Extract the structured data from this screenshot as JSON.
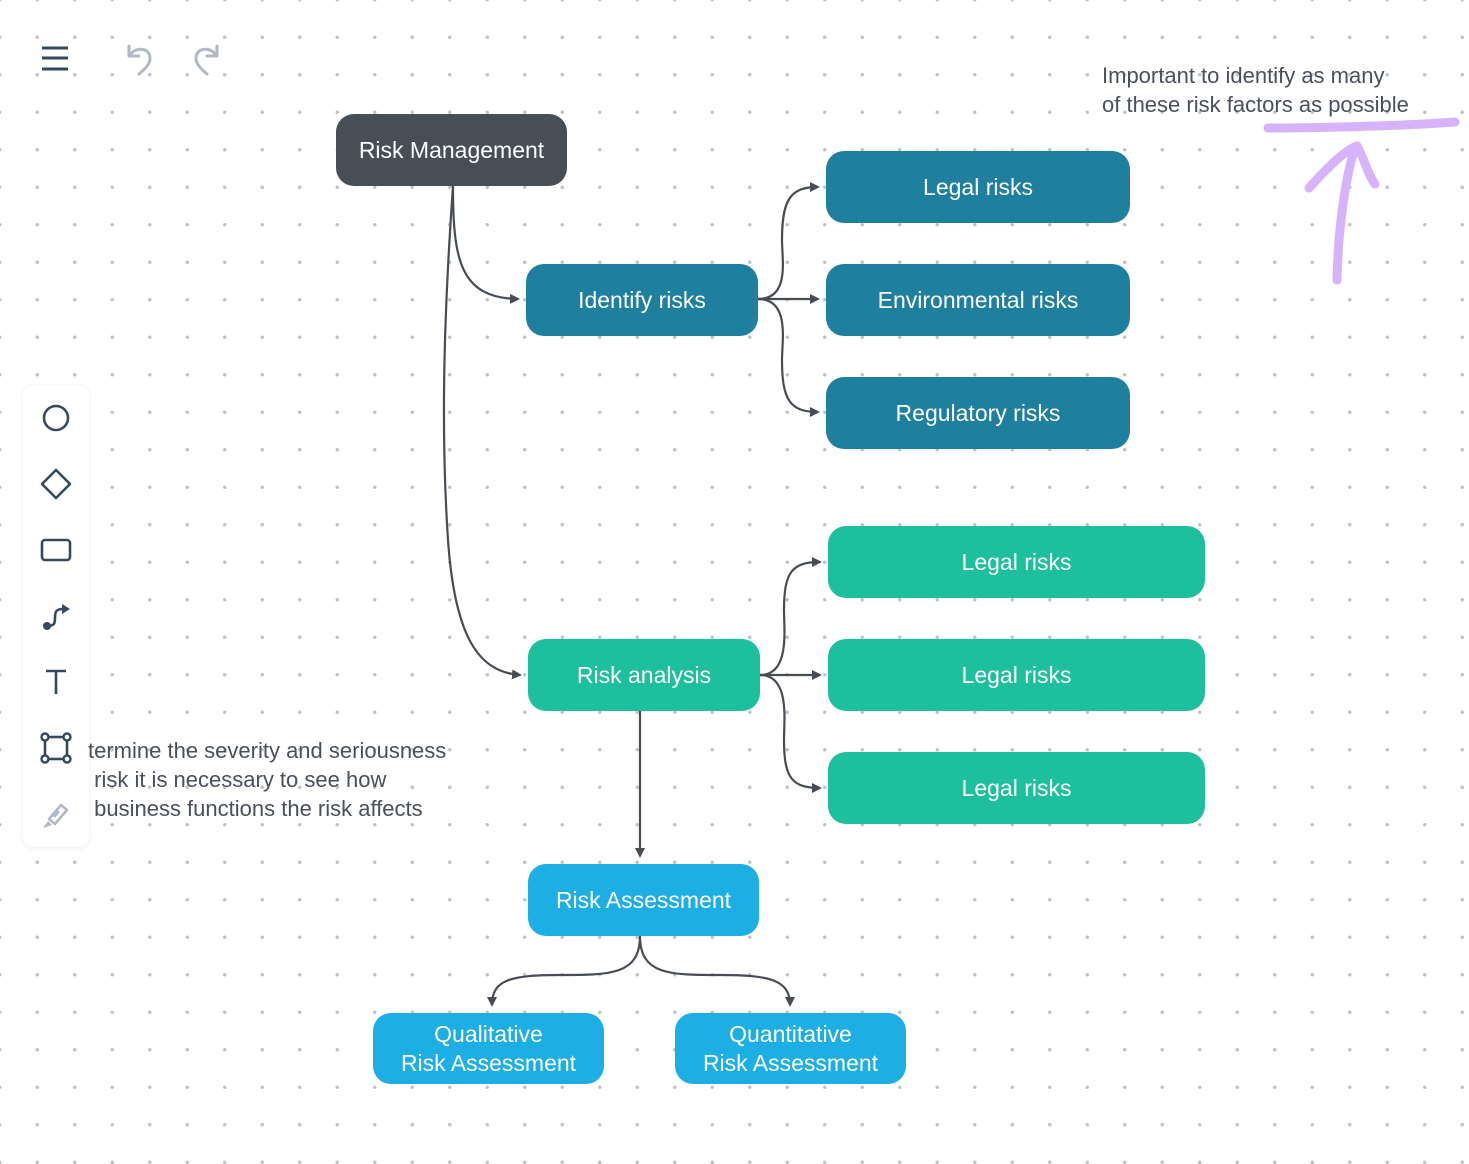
{
  "topbar": {
    "menu_icon": "hamburger-menu-icon",
    "undo_icon": "undo-icon",
    "redo_icon": "redo-icon"
  },
  "toolbar": {
    "tools": [
      {
        "name": "circle-tool",
        "icon": "circle-icon"
      },
      {
        "name": "diamond-tool",
        "icon": "diamond-icon"
      },
      {
        "name": "rectangle-tool",
        "icon": "rectangle-icon"
      },
      {
        "name": "connector-tool",
        "icon": "connector-icon"
      },
      {
        "name": "text-tool",
        "icon": "text-icon"
      },
      {
        "name": "frame-tool",
        "icon": "frame-icon"
      },
      {
        "name": "pen-tool",
        "icon": "pen-icon"
      }
    ]
  },
  "colors": {
    "root": "#484e56",
    "identify": "#1e7f9e",
    "analysis": "#1dbf9c",
    "assessment": "#1daee3",
    "edge": "#474c55",
    "annotation": "#d7b3fb"
  },
  "nodes": {
    "root": "Risk Management",
    "identify": "Identify risks",
    "identify_children": [
      "Legal risks",
      "Environmental risks",
      "Regulatory risks"
    ],
    "analysis": "Risk analysis",
    "analysis_children": [
      "Legal risks",
      "Legal risks",
      "Legal risks"
    ],
    "assessment": "Risk Assessment",
    "assessment_children": [
      "Qualitative\nRisk Assessment",
      "Quantitative\nRisk Assessment"
    ]
  },
  "notes": {
    "top_right": "Important to identify as many\nof these risk factors as possible",
    "left": "termine the severity and seriousness\n risk it is necessary to see how\n business functions the risk affects"
  },
  "edges": [
    {
      "from": "root",
      "to": "identify"
    },
    {
      "from": "root",
      "to": "analysis"
    },
    {
      "from": "identify",
      "to": "identify_children.0"
    },
    {
      "from": "identify",
      "to": "identify_children.1"
    },
    {
      "from": "identify",
      "to": "identify_children.2"
    },
    {
      "from": "analysis",
      "to": "analysis_children.0"
    },
    {
      "from": "analysis",
      "to": "analysis_children.1"
    },
    {
      "from": "analysis",
      "to": "analysis_children.2"
    },
    {
      "from": "analysis",
      "to": "assessment"
    },
    {
      "from": "assessment",
      "to": "assessment_children.0"
    },
    {
      "from": "assessment",
      "to": "assessment_children.1"
    }
  ]
}
